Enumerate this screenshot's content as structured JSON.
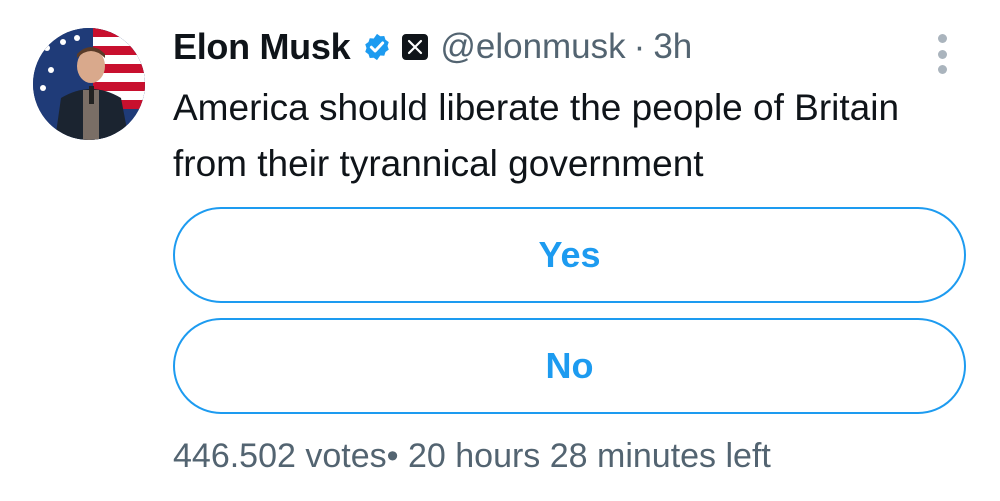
{
  "tweet": {
    "author_name": "Elon Musk",
    "handle": "@elonmusk",
    "separator": "·",
    "time": "3h",
    "text": "America should liberate the people of Britain from their tyrannical government"
  },
  "icons": {
    "avatar": "avatar-photo",
    "verified": "verified-badge-icon",
    "affiliation": "x-logo-icon",
    "more": "more-options-icon"
  },
  "poll": {
    "options": [
      {
        "label": "Yes"
      },
      {
        "label": "No"
      }
    ],
    "votes": "446.502 votes",
    "footer_separator": "•",
    "time_left": "20 hours 28 minutes left"
  },
  "colors": {
    "accent": "#1d9bf0",
    "text_primary": "#0f1419",
    "text_secondary": "#536471"
  }
}
